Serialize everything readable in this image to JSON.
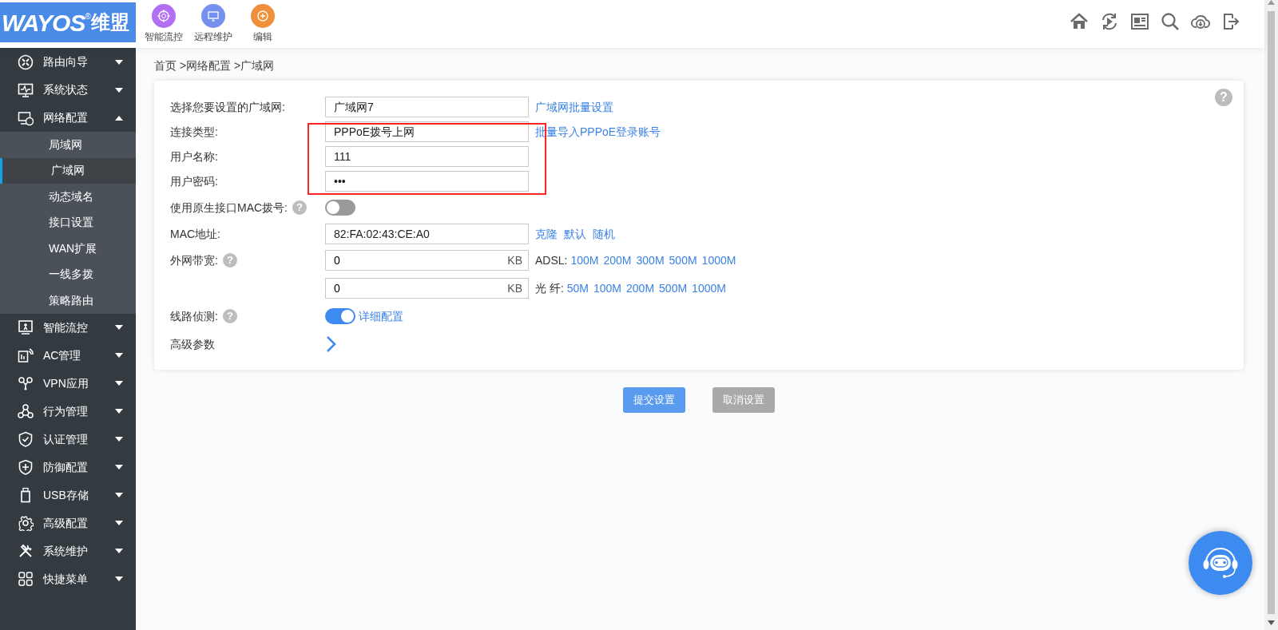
{
  "header": {
    "logo": {
      "brand": "WAYOS",
      "reg": "®",
      "suffix": "维盟"
    },
    "shortcuts": [
      {
        "label": "智能流控",
        "color": "#b26ff2"
      },
      {
        "label": "远程维护",
        "color": "#7690ee"
      },
      {
        "label": "编辑",
        "color": "#f0903a"
      }
    ]
  },
  "sidebar": {
    "items": [
      {
        "label": "路由向导",
        "expanded": false
      },
      {
        "label": "系统状态",
        "expanded": false
      },
      {
        "label": "网络配置",
        "expanded": true,
        "children": [
          {
            "label": "局域网",
            "selected": false
          },
          {
            "label": "广域网",
            "selected": true
          },
          {
            "label": "动态域名",
            "selected": false
          },
          {
            "label": "接口设置",
            "selected": false
          },
          {
            "label": "WAN扩展",
            "selected": false
          },
          {
            "label": "一线多拨",
            "selected": false
          },
          {
            "label": "策略路由",
            "selected": false
          }
        ]
      },
      {
        "label": "智能流控",
        "expanded": false
      },
      {
        "label": "AC管理",
        "expanded": false
      },
      {
        "label": "VPN应用",
        "expanded": false
      },
      {
        "label": "行为管理",
        "expanded": false
      },
      {
        "label": "认证管理",
        "expanded": false
      },
      {
        "label": "防御配置",
        "expanded": false
      },
      {
        "label": "USB存储",
        "expanded": false
      },
      {
        "label": "高级配置",
        "expanded": false
      },
      {
        "label": "系统维护",
        "expanded": false
      },
      {
        "label": "快捷菜单",
        "expanded": false
      }
    ]
  },
  "breadcrumb": "首页 >网络配置 >广域网",
  "form": {
    "help": "?",
    "rows": [
      {
        "kind": "select",
        "label": "选择您要设置的广域网:",
        "value": "广域网7",
        "links": [
          "广域网批量设置"
        ],
        "highlighted": false
      },
      {
        "kind": "select",
        "label": "连接类型:",
        "value": "PPPoE拨号上网",
        "links": [
          "批量导入PPPoE登录账号"
        ],
        "highlighted": true
      },
      {
        "kind": "text",
        "label": "用户名称:",
        "value": "111",
        "highlighted": true
      },
      {
        "kind": "text",
        "label": "用户密码:",
        "value": "•••",
        "highlighted": true
      },
      {
        "kind": "toggle",
        "label": "使用原生接口MAC拨号:",
        "help": "?",
        "on": false,
        "highlighted": false
      },
      {
        "kind": "text",
        "label": "MAC地址:",
        "value": "82:FA:02:43:CE:A0",
        "links": [
          "克隆",
          "默认",
          "随机"
        ],
        "highlighted": false
      },
      {
        "kind": "bandwidth",
        "label": "外网带宽:",
        "help": "?",
        "value": "0",
        "unit": "KB",
        "preset_label": "ADSL:",
        "links": [
          "100M",
          "200M",
          "300M",
          "500M",
          "1000M"
        ],
        "highlighted": false
      },
      {
        "kind": "bandwidth",
        "value": "0",
        "unit": "KB",
        "preset_label": "光 纤:",
        "links": [
          "50M",
          "100M",
          "200M",
          "500M",
          "1000M"
        ],
        "highlighted": false
      },
      {
        "kind": "toggle",
        "label": "线路侦测:",
        "help": "?",
        "on": true,
        "links": [
          "详细配置"
        ],
        "highlighted": false
      },
      {
        "kind": "arrow",
        "label": "高级参数",
        "highlighted": false
      }
    ]
  },
  "buttons": [
    {
      "label": "提交设置",
      "kind": "primary"
    },
    {
      "label": "取消设置",
      "kind": "secondary"
    }
  ]
}
